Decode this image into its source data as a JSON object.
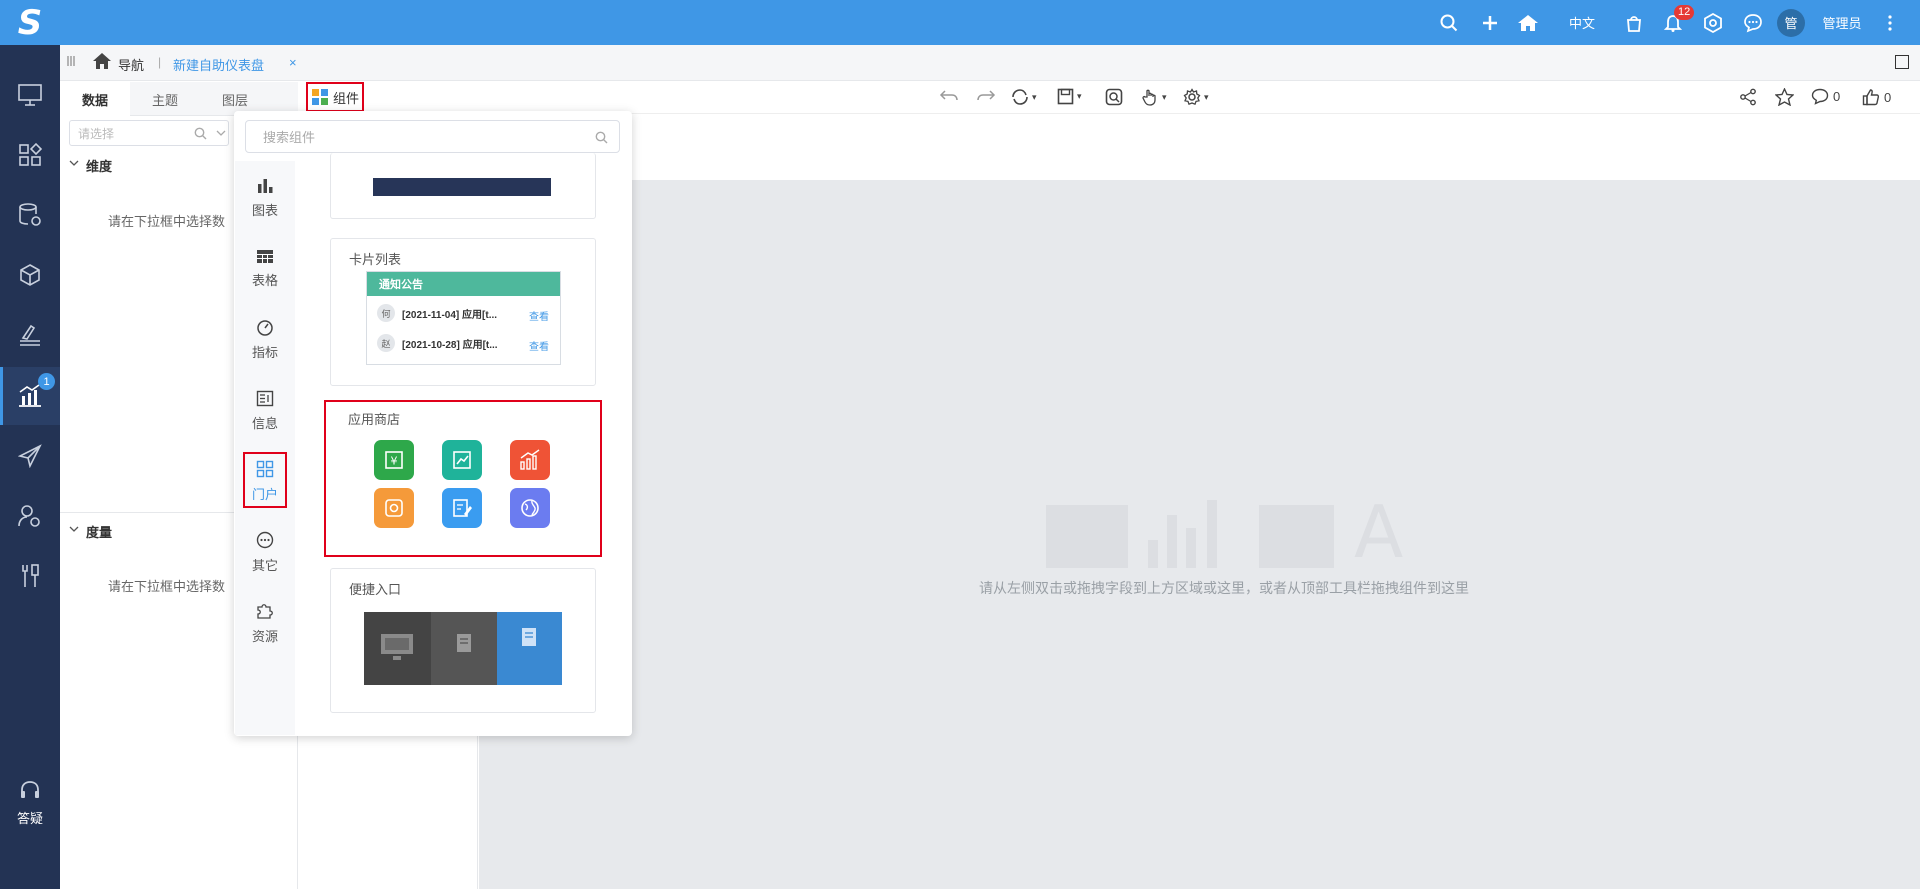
{
  "top_bar": {
    "logo_letter": "S",
    "language": "中文",
    "notification_count": "12",
    "avatar_char": "管",
    "user_name": "管理员"
  },
  "left_nav": {
    "analysis_badge": "1",
    "help_label": "答疑"
  },
  "breadcrumb": {
    "nav_label": "导航",
    "separator": "|",
    "tab_label": "新建自助仪表盘",
    "close": "×"
  },
  "data_panel": {
    "tabs": [
      "数据",
      "主题",
      "图层"
    ],
    "search_placeholder": "请选择",
    "dimension_title": "维度",
    "dimension_hint": "请在下拉框中选择数",
    "measure_title": "度量",
    "measure_hint": "请在下拉框中选择数"
  },
  "toolbar": {
    "component_label": "组件",
    "comment_count": "0",
    "like_count": "0"
  },
  "canvas": {
    "hint": "请从左侧双击或拖拽字段到上方区域或这里，或者从顶部工具栏拖拽组件到这里",
    "watermark_letter": "A"
  },
  "component_popup": {
    "search_placeholder": "搜索组件",
    "categories": [
      {
        "label": "图表",
        "icon": "bar-chart-icon"
      },
      {
        "label": "表格",
        "icon": "table-icon"
      },
      {
        "label": "指标",
        "icon": "gauge-icon"
      },
      {
        "label": "信息",
        "icon": "info-icon"
      },
      {
        "label": "门户",
        "icon": "portal-icon"
      },
      {
        "label": "其它",
        "icon": "more-icon"
      },
      {
        "label": "资源",
        "icon": "puzzle-icon"
      }
    ],
    "active_category": "门户",
    "card_list_title": "卡片列表",
    "notice": {
      "header": "通知公告",
      "rows": [
        {
          "avatar": "何",
          "text": "[2021-11-04]  应用[t...",
          "action": "查看"
        },
        {
          "avatar": "赵",
          "text": "[2021-10-28]  应用[t...",
          "action": "查看"
        }
      ]
    },
    "app_store_title": "应用商店",
    "app_icons": [
      {
        "name": "finance-app-icon",
        "color": "#2ea84a"
      },
      {
        "name": "report-app-icon",
        "color": "#1fb39a"
      },
      {
        "name": "growth-chart-app-icon",
        "color": "#ef5336"
      },
      {
        "name": "analysis-app-icon",
        "color": "#f59a3a"
      },
      {
        "name": "edit-app-icon",
        "color": "#3a9cf0"
      },
      {
        "name": "globe-app-icon",
        "color": "#6b7cf0"
      }
    ],
    "quick_entry_title": "便捷入口"
  }
}
